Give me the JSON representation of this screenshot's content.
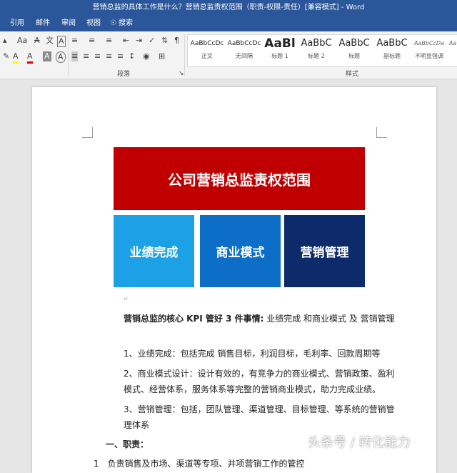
{
  "window": {
    "title": "营销总监的具体工作是什么？营销总监责权范围（职责-权限-责任）[兼容模式] - Word"
  },
  "menu_tabs": [
    "引用",
    "邮件",
    "审阅",
    "视图"
  ],
  "search": {
    "label": "搜索"
  },
  "ribbon": {
    "paragraph_label": "段落",
    "styles_label": "样式",
    "font_row1": [
      "Aa",
      "A",
      "文",
      "A"
    ],
    "font_row2": [
      "A",
      "A",
      "A",
      "A"
    ],
    "styles": [
      {
        "preview": "AaBbCcDc",
        "name": "正文"
      },
      {
        "preview": "AaBbCcDc",
        "name": "无间隔"
      },
      {
        "preview": "AaBl",
        "name": "标题 1"
      },
      {
        "preview": "AaBbC",
        "name": "标题 2"
      },
      {
        "preview": "AaBbC",
        "name": "标题"
      },
      {
        "preview": "AaBbC",
        "name": "副标题"
      },
      {
        "preview": "AaBbCcDa",
        "name": "不明显强调"
      },
      {
        "preview": "Aa",
        "name": ""
      }
    ]
  },
  "diagram": {
    "top": "公司营销总监责权范围",
    "boxes": [
      "业绩完成",
      "商业模式",
      "营销管理"
    ]
  },
  "document": {
    "kpi_bold": "营销总监的核心 KPI 管好 3 件事情:",
    "kpi_rest": " 业绩完成 和商业模式 及 营销管理",
    "item1": "1、业绩完成：包括完成 销售目标，利润目标，毛利率、回款周期等",
    "item2": "2、商业模式设计：设计有效的，有竞争力的商业模式、营销政策、盈利模式、经营体系，服务体系等完整的营销商业模式，助力完成业绩。",
    "item3": "3、营销管理：包括，团队管理、渠道管理、目标管理、等系统的营销管理体系",
    "duties_heading": "一、职责：",
    "list_num": "1",
    "list_text": "负责销售及市场、渠道等专项、并项营销工作的管控"
  },
  "watermark": "头条号 / 转化能力",
  "colors": {
    "accent": "#2b579a",
    "top_box": "#c00000",
    "box1": "#1da1e6",
    "box2": "#0c6ec6",
    "box3": "#0d2b6b"
  }
}
